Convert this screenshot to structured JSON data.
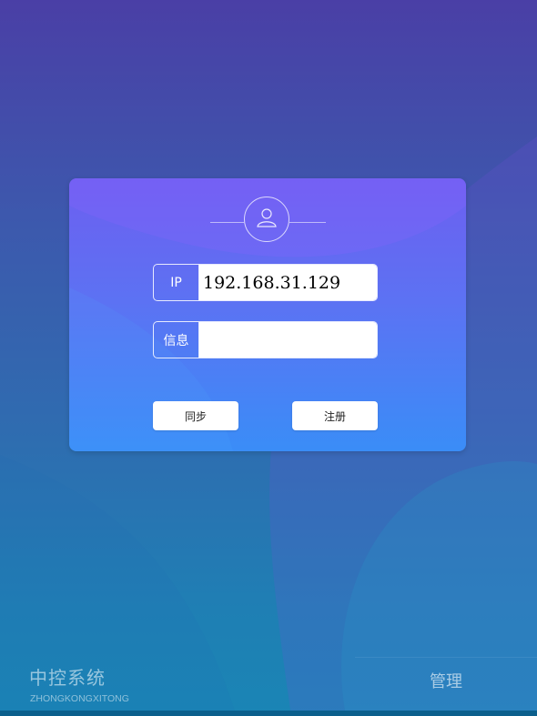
{
  "login": {
    "ip_label": "IP",
    "ip_value": "192.168.31.129",
    "info_label": "信息",
    "info_value": "",
    "sync_label": "同步",
    "register_label": "注册"
  },
  "footer": {
    "brand_title": "中控系统",
    "brand_subtitle": "ZHONGKONGXITONG",
    "manage_label": "管理"
  },
  "icons": {
    "avatar": "user-icon"
  },
  "colors": {
    "bg_top": "#4a3fa6",
    "bg_bottom": "#1a85b5",
    "card_top": "#6d5ff0",
    "card_bottom": "#3a8df7",
    "input_bg": "#ffffff"
  }
}
